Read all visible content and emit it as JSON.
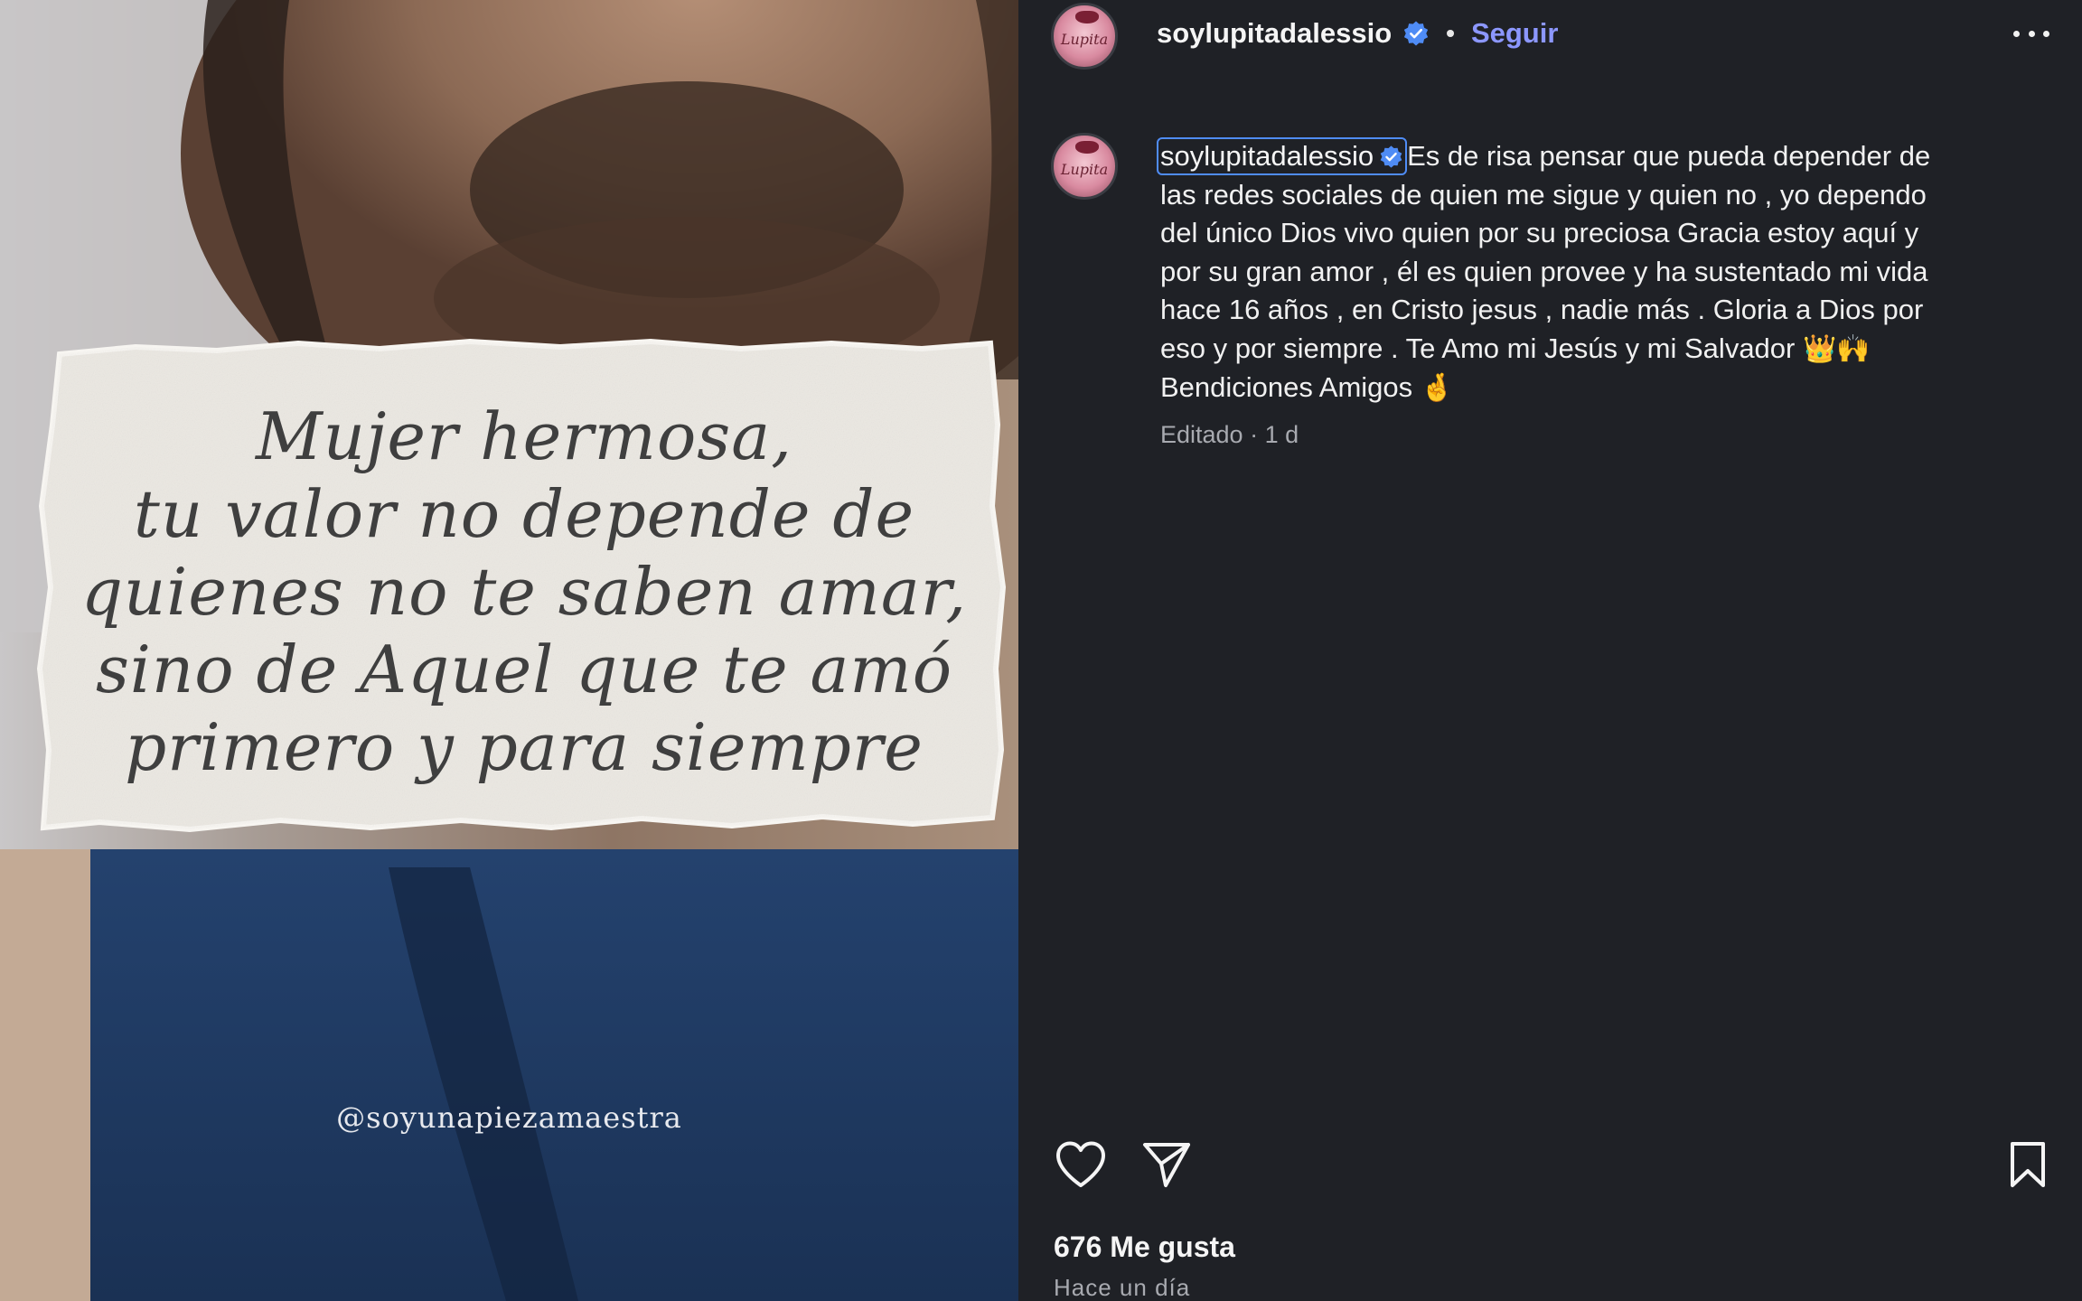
{
  "post_image": {
    "note_lines": [
      "Mujer hermosa,",
      "tu valor no depende de",
      "quienes no te saben amar,",
      "sino de Aquel que te amó",
      "primero y para siempre"
    ],
    "watermark": "@soyunapiezamaestra"
  },
  "header": {
    "username": "soylupitadalessio",
    "separator": "•",
    "follow_label": "Seguir",
    "avatar_text": "Lupita"
  },
  "caption": {
    "username": "soylupitadalessio",
    "lines": [
      "Es de risa pensar que pueda depender de",
      "las redes sociales de quien me sigue y quien no , yo dependo",
      "del único Dios vivo quien por su preciosa Gracia estoy aquí y",
      "por su gran amor , él es quien provee y ha sustentado mi vida",
      "hace 16 años , en Cristo jesus , nadie más . Gloria a Dios por",
      "eso y por siempre . Te Amo mi Jesús y mi Salvador",
      "Bendiciones Amigos"
    ],
    "emoji_1": "👑🙌",
    "emoji_2": "🤞",
    "meta": "Editado · 1 d"
  },
  "actions": {
    "icons": [
      "heart-icon",
      "send-icon",
      "bookmark-icon"
    ]
  },
  "footer": {
    "likes": "676 Me gusta",
    "time": "Hace un día"
  },
  "colors": {
    "background": "#1f2126",
    "accent": "#8c97ff",
    "verified": "#4f8cf5",
    "muted": "#a8aab0"
  }
}
